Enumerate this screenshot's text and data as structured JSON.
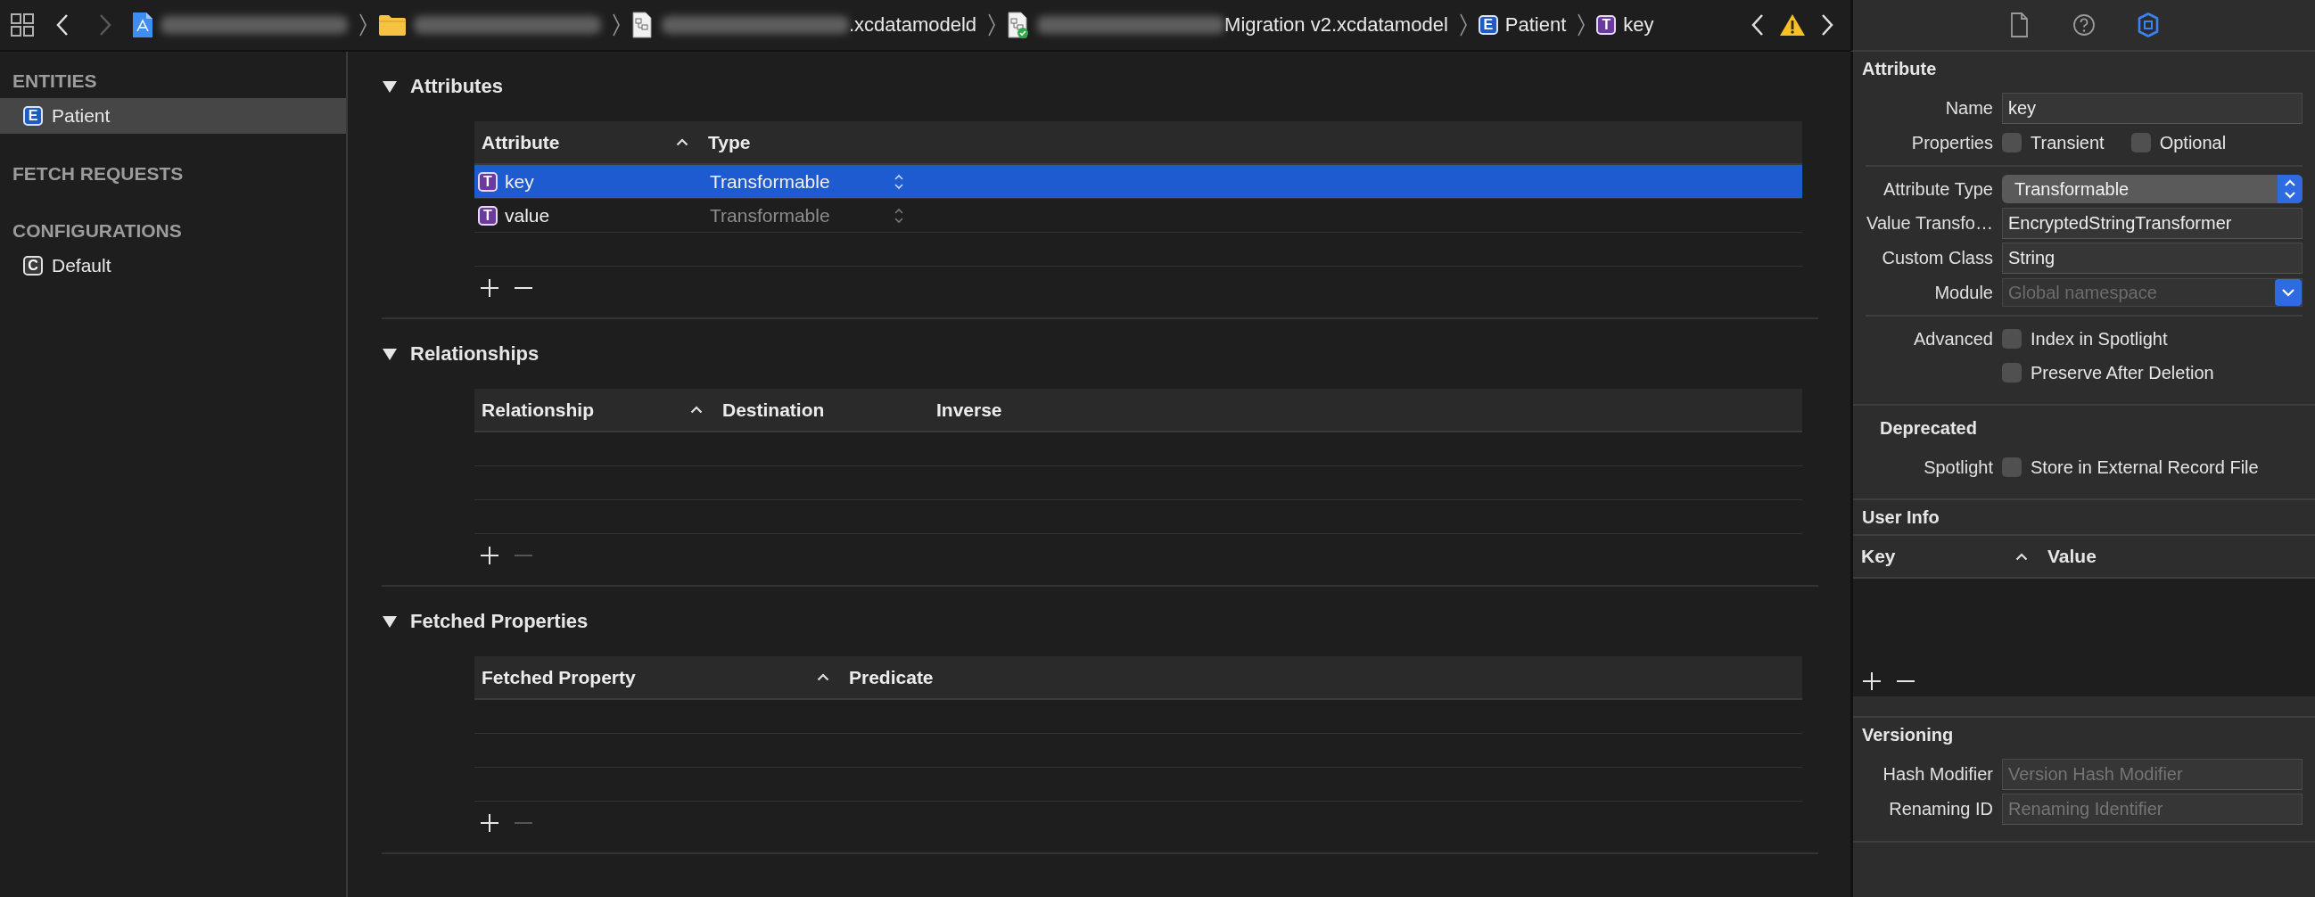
{
  "toolbar": {
    "navigation": [
      {
        "kind": "back",
        "disabled": false
      },
      {
        "kind": "forward",
        "disabled": true
      }
    ],
    "path": [
      {
        "blurred": true
      },
      {
        "blurred": true
      },
      {
        "blurred": true,
        "text": ".xcdatamodeld"
      },
      {
        "blurred": true,
        "text": "Migration v2.xcdatamodel"
      },
      {
        "badge": {
          "letter": "E",
          "kind": "entity"
        },
        "text": "Patient"
      },
      {
        "badge": {
          "letter": "T",
          "kind": "attribute"
        },
        "text": "key"
      }
    ],
    "issue": {
      "kind": "warning"
    }
  },
  "sidebar": {
    "sections": [
      {
        "title": "ENTITIES",
        "items": [
          {
            "badge": {
              "letter": "E",
              "kind": "entity"
            },
            "label": "Patient",
            "selected": true
          }
        ]
      },
      {
        "title": "FETCH REQUESTS"
      },
      {
        "title": "CONFIGURATIONS",
        "items": [
          {
            "badge": {
              "letter": "C",
              "kind": "configuration"
            },
            "label": "Default",
            "selected": false
          }
        ]
      }
    ]
  },
  "editor": {
    "sections": [
      {
        "title": "Attributes",
        "expanded": true,
        "columns": [
          {
            "label": "Attribute",
            "sorted": true
          },
          {
            "label": "Type",
            "sorted": false
          }
        ],
        "rows": [
          {
            "badge": {
              "letter": "T",
              "kind": "attribute"
            },
            "name": "key",
            "type": "Transformable",
            "selected": true
          },
          {
            "badge": {
              "letter": "T",
              "kind": "attribute"
            },
            "name": "value",
            "type": "Transformable",
            "selected": false
          }
        ],
        "remove_disabled": false
      },
      {
        "title": "Relationships",
        "expanded": true,
        "columns": [
          {
            "label": "Relationship",
            "sorted": true
          },
          {
            "label": "Destination",
            "sorted": false
          },
          {
            "label": "Inverse",
            "sorted": false
          }
        ],
        "remove_disabled": true
      },
      {
        "title": "Fetched Properties",
        "expanded": true,
        "columns": [
          {
            "label": "Fetched Property",
            "sorted": true
          },
          {
            "label": "Predicate",
            "sorted": false
          }
        ],
        "remove_disabled": true
      }
    ]
  },
  "inspector": {
    "tabs": [
      {
        "selected": false
      },
      {
        "selected": false
      },
      {
        "selected": true
      }
    ],
    "sections": [
      {
        "title": "Attribute",
        "kind": "form",
        "groups": [
          [
            {
              "kind": "text",
              "label": "Name",
              "value": "key"
            },
            {
              "kind": "checkboxes",
              "label": "Properties",
              "options": [
                {
                  "label": "Transient",
                  "checked": false
                },
                {
                  "label": "Optional",
                  "checked": false
                }
              ]
            }
          ],
          [
            {
              "kind": "popup",
              "label": "Attribute Type",
              "value": "Transformable"
            },
            {
              "kind": "text",
              "label": "Value Transfo…",
              "value": "EncryptedStringTransformer"
            },
            {
              "kind": "text",
              "label": "Custom Class",
              "value": "String"
            },
            {
              "kind": "combo",
              "label": "Module",
              "placeholder": "Global namespace"
            }
          ],
          [
            {
              "kind": "checkboxes",
              "label": "Advanced",
              "options": [
                {
                  "label": "Index in Spotlight",
                  "checked": false
                }
              ]
            },
            {
              "kind": "checkboxes",
              "options": [
                {
                  "label": "Preserve After Deletion",
                  "checked": false
                }
              ]
            }
          ]
        ]
      },
      {
        "title": "Deprecated",
        "kind": "subform",
        "groups": [
          [
            {
              "kind": "checkboxes",
              "label": "Spotlight",
              "options": [
                {
                  "label": "Store in External Record File",
                  "checked": false
                }
              ]
            }
          ]
        ]
      },
      {
        "title": "User Info",
        "kind": "table",
        "columns": [
          {
            "label": "Key",
            "sorted": true
          },
          {
            "label": "Value",
            "sorted": false
          }
        ],
        "remove_disabled": false
      },
      {
        "title": "Versioning",
        "kind": "form",
        "groups": [
          [
            {
              "kind": "text",
              "label": "Hash Modifier",
              "placeholder": "Version Hash Modifier"
            },
            {
              "kind": "text",
              "label": "Renaming ID",
              "placeholder": "Renaming Identifier"
            }
          ]
        ]
      }
    ]
  }
}
